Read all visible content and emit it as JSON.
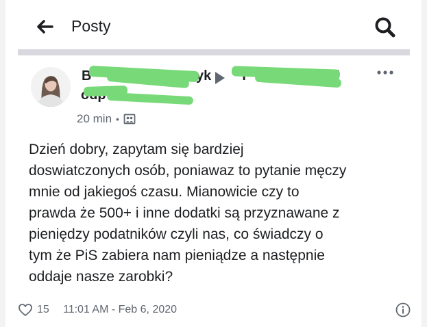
{
  "header": {
    "title": "Posty",
    "back_icon": "arrow-left-icon",
    "search_icon": "search-icon"
  },
  "post": {
    "author_redacted": true,
    "author_fragments": {
      "first": "B",
      "second": "yk",
      "third": "T",
      "fourth": "i",
      "second_line": "odp"
    },
    "time": "20 min",
    "separator": "•",
    "privacy_icon": "group-icon",
    "more_icon": "more-dots-icon",
    "text": "Dzień dobry, zapytam się bardziej\ndoswiatczonych osób, poniawaz to pytanie męczy\nmnie od jakiegoś czasu. Mianowicie czy to\nprawda że 500+ i inne dodatki są przyznawane z\npieniędzy podatników czyli nas, co świadczy o\ntym że PiS zabiera nam pieniądze a następnie\noddaje nasze zarobki?",
    "likes": "15",
    "timestamp": "11:01 AM - Feb 6, 2020",
    "like_icon": "heart-outline-icon",
    "info_icon": "info-icon"
  },
  "colors": {
    "redaction": "#77d977",
    "secondary_text": "#606770",
    "divider": "#d9d8df"
  }
}
